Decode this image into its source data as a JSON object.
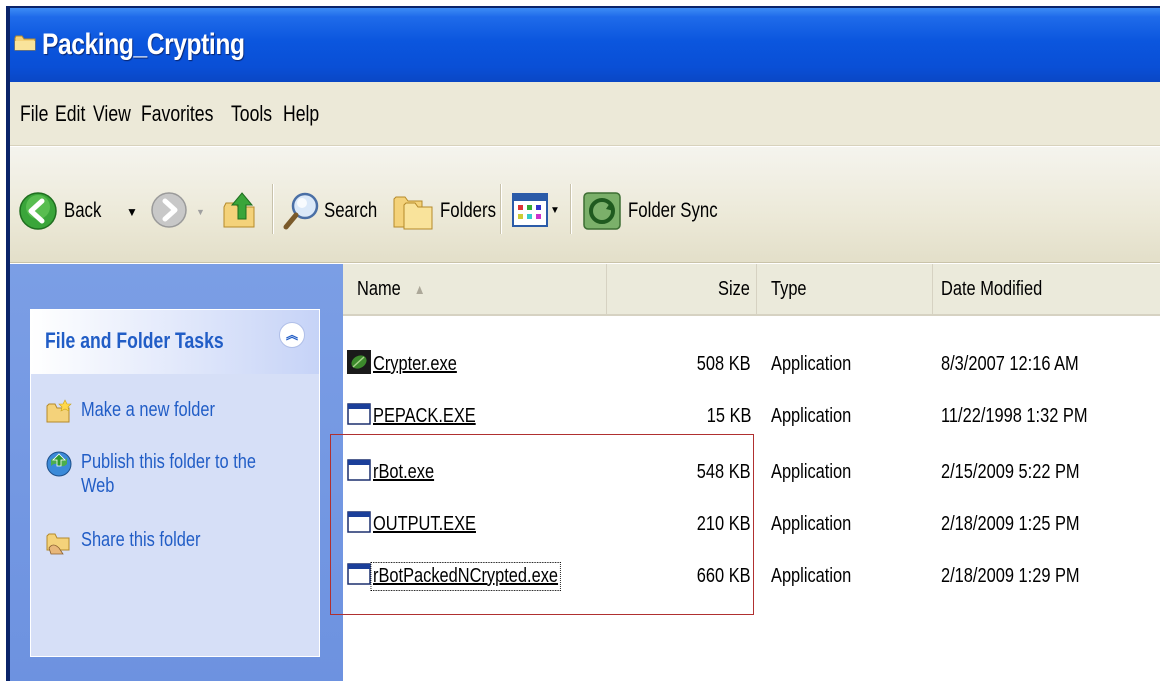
{
  "window": {
    "title": "Packing_Crypting"
  },
  "menu": [
    "File",
    "Edit",
    "View",
    "Favorites",
    "Tools",
    "Help"
  ],
  "toolbar": {
    "back_label": "Back",
    "search_label": "Search",
    "folders_label": "Folders",
    "folder_sync_label": "Folder Sync"
  },
  "task_pane": {
    "header": "File and Folder Tasks",
    "tasks": [
      {
        "label": "Make a new folder",
        "icon": "new-folder-icon"
      },
      {
        "label": "Publish this folder to the Web",
        "icon": "publish-web-icon"
      },
      {
        "label": "Share this folder",
        "icon": "share-folder-icon"
      }
    ]
  },
  "file_list": {
    "columns": [
      "Name",
      "Size",
      "Type",
      "Date Modified"
    ],
    "sorted_by": "Name",
    "files": [
      {
        "name": "Crypter.exe",
        "size": "508 KB",
        "type": "Application",
        "date": "8/3/2007 12:16 AM",
        "icon": "crypter-app-icon"
      },
      {
        "name": "PEPACK.EXE",
        "size": "15 KB",
        "type": "Application",
        "date": "11/22/1998 1:32 PM",
        "icon": "application-icon"
      },
      {
        "name": "rBot.exe",
        "size": "548 KB",
        "type": "Application",
        "date": "2/15/2009 5:22 PM",
        "icon": "application-icon"
      },
      {
        "name": "OUTPUT.EXE",
        "size": "210 KB",
        "type": "Application",
        "date": "2/18/2009 1:25 PM",
        "icon": "application-icon"
      },
      {
        "name": "rBotPackedNCrypted.exe",
        "size": "660 KB",
        "type": "Application",
        "date": "2/18/2009 1:29 PM",
        "icon": "application-icon"
      }
    ]
  },
  "colors": {
    "title_bar": "#0a4fd6",
    "task_pane": "#6d92e0",
    "task_link": "#215dc6",
    "highlight_box": "#b03030"
  }
}
